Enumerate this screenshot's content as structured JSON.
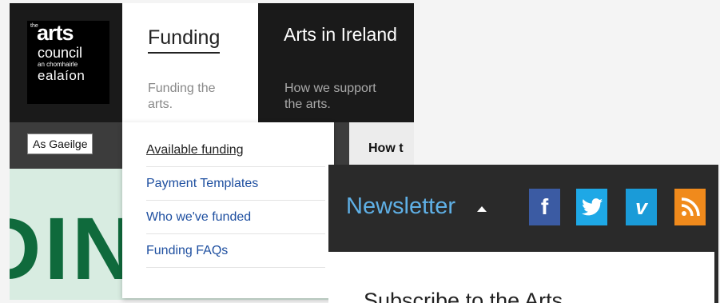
{
  "logo": {
    "small_text": "the",
    "arts": "arts",
    "council": "council",
    "chomhairle": "an chomhairle",
    "ealaion": "ealaíon"
  },
  "nav": {
    "funding": {
      "title": "Funding",
      "subtitle": "Funding the arts."
    },
    "arts_in_ireland": {
      "title": "Arts in Ireland",
      "subtitle": "How we support the arts."
    }
  },
  "subbar": {
    "language_button": "As Gaeilge",
    "howto_label": "How t"
  },
  "dropdown": {
    "items": [
      {
        "label": "Available funding"
      },
      {
        "label": "Payment Templates"
      },
      {
        "label": "Who we've funded"
      },
      {
        "label": "Funding FAQs"
      }
    ]
  },
  "hero": {
    "text": "DIN"
  },
  "footer": {
    "newsletter_label": "Newsletter",
    "subscribe_text": "Subscribe to the Arts"
  },
  "social": {
    "facebook": "f",
    "twitter": "twitter-icon",
    "vimeo": "v",
    "rss": "rss-icon"
  },
  "colors": {
    "link_blue": "#1e4fa0",
    "newsletter_blue": "#5fb0e6",
    "facebook": "#3b5ba3",
    "twitter": "#1ea8e6",
    "vimeo": "#1a9bd8",
    "rss": "#f08a1c",
    "hero_green": "#0f6a3c"
  }
}
